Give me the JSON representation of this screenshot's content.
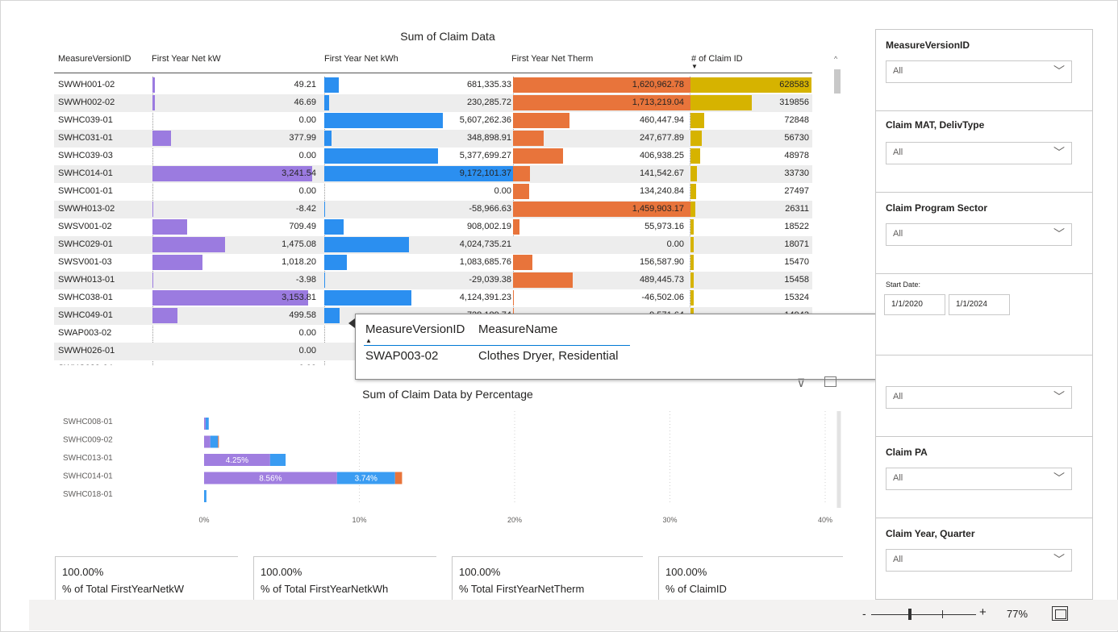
{
  "table": {
    "title": "Sum of Claim Data",
    "headers": [
      "MeasureVersionID",
      "First Year Net kW",
      "First Year Net kWh",
      "First Year Net Therm",
      "# of Claim ID"
    ],
    "rows": [
      {
        "id": "SWWH001-02",
        "kw": "49.21",
        "kwh": "681,335.33",
        "therm": "1,620,962.78",
        "claims": "628583",
        "kw_n": 49.21,
        "kwh_n": 681335.33,
        "therm_n": 1620962.78,
        "claims_n": 628583
      },
      {
        "id": "SWWH002-02",
        "kw": "46.69",
        "kwh": "230,285.72",
        "therm": "1,713,219.04",
        "claims": "319856",
        "kw_n": 46.69,
        "kwh_n": 230285.72,
        "therm_n": 1713219.04,
        "claims_n": 319856
      },
      {
        "id": "SWHC039-01",
        "kw": "0.00",
        "kwh": "5,607,262.36",
        "therm": "460,447.94",
        "claims": "72848",
        "kw_n": 0,
        "kwh_n": 5607262.36,
        "therm_n": 460447.94,
        "claims_n": 72848
      },
      {
        "id": "SWHC031-01",
        "kw": "377.99",
        "kwh": "348,898.91",
        "therm": "247,677.89",
        "claims": "56730",
        "kw_n": 377.99,
        "kwh_n": 348898.91,
        "therm_n": 247677.89,
        "claims_n": 56730
      },
      {
        "id": "SWHC039-03",
        "kw": "0.00",
        "kwh": "5,377,699.27",
        "therm": "406,938.25",
        "claims": "48978",
        "kw_n": 0,
        "kwh_n": 5377699.27,
        "therm_n": 406938.25,
        "claims_n": 48978
      },
      {
        "id": "SWHC014-01",
        "kw": "3,241.54",
        "kwh": "9,172,101.37",
        "therm": "141,542.67",
        "claims": "33730",
        "kw_n": 3241.54,
        "kwh_n": 9172101.37,
        "therm_n": 141542.67,
        "claims_n": 33730
      },
      {
        "id": "SWHC001-01",
        "kw": "0.00",
        "kwh": "0.00",
        "therm": "134,240.84",
        "claims": "27497",
        "kw_n": 0,
        "kwh_n": 0,
        "therm_n": 134240.84,
        "claims_n": 27497
      },
      {
        "id": "SWWH013-02",
        "kw": "-8.42",
        "kwh": "-58,966.63",
        "therm": "1,459,903.17",
        "claims": "26311",
        "kw_n": -8.42,
        "kwh_n": -58966.63,
        "therm_n": 1459903.17,
        "claims_n": 26311
      },
      {
        "id": "SWSV001-02",
        "kw": "709.49",
        "kwh": "908,002.19",
        "therm": "55,973.16",
        "claims": "18522",
        "kw_n": 709.49,
        "kwh_n": 908002.19,
        "therm_n": 55973.16,
        "claims_n": 18522
      },
      {
        "id": "SWHC029-01",
        "kw": "1,475.08",
        "kwh": "4,024,735.21",
        "therm": "0.00",
        "claims": "18071",
        "kw_n": 1475.08,
        "kwh_n": 4024735.21,
        "therm_n": 0,
        "claims_n": 18071
      },
      {
        "id": "SWSV001-03",
        "kw": "1,018.20",
        "kwh": "1,083,685.76",
        "therm": "156,587.90",
        "claims": "15470",
        "kw_n": 1018.2,
        "kwh_n": 1083685.76,
        "therm_n": 156587.9,
        "claims_n": 15470
      },
      {
        "id": "SWWH013-01",
        "kw": "-3.98",
        "kwh": "-29,039.38",
        "therm": "489,445.73",
        "claims": "15458",
        "kw_n": -3.98,
        "kwh_n": -29039.38,
        "therm_n": 489445.73,
        "claims_n": 15458
      },
      {
        "id": "SWHC038-01",
        "kw": "3,153.81",
        "kwh": "4,124,391.23",
        "therm": "-46,502.06",
        "claims": "15324",
        "kw_n": 3153.81,
        "kwh_n": 4124391.23,
        "therm_n": -46502.06,
        "claims_n": 15324
      },
      {
        "id": "SWHC049-01",
        "kw": "499.58",
        "kwh": "728,189.74",
        "therm": "-9,571.64",
        "claims": "14943",
        "kw_n": 499.58,
        "kwh_n": 728189.74,
        "therm_n": -9571.64,
        "claims_n": 14943
      },
      {
        "id": "SWAP003-02",
        "kw": "0.00",
        "kwh": "",
        "therm": "",
        "claims": "",
        "kw_n": 0,
        "kwh_n": 0,
        "therm_n": 0,
        "claims_n": 0
      },
      {
        "id": "SWWH026-01",
        "kw": "0.00",
        "kwh": "",
        "therm": "",
        "claims": "",
        "kw_n": 0,
        "kwh_n": 0,
        "therm_n": 0,
        "claims_n": 0
      },
      {
        "id": "SWHC039-04",
        "kw": "0.00",
        "kwh": "",
        "therm": "",
        "claims": "",
        "kw_n": 0,
        "kwh_n": 0,
        "therm_n": 0,
        "claims_n": 0
      }
    ]
  },
  "tooltip": {
    "headers": [
      "MeasureVersionID",
      "MeasureName"
    ],
    "id": "SWAP003-02",
    "name": "Clothes Dryer, Residential"
  },
  "chart_data": {
    "type": "bar",
    "title": "Sum of Claim Data by Percentage",
    "categories": [
      "SWHC008-01",
      "SWHC009-02",
      "SWHC013-01",
      "SWHC014-01",
      "SWHC018-01"
    ],
    "series": [
      {
        "values": [
          0.1,
          0.4,
          4.25,
          8.56,
          0.0
        ],
        "color": "#a07ee0"
      },
      {
        "values": [
          0.2,
          0.5,
          1.0,
          3.74,
          0.15
        ],
        "color": "#3a9cf2"
      },
      {
        "values": [
          0.0,
          0.05,
          0.0,
          0.45,
          0.0
        ],
        "color": "#e8743b"
      }
    ],
    "data_labels": [
      {
        "category": "SWHC013-01",
        "series": 0,
        "text": "4.25%"
      },
      {
        "category": "SWHC014-01",
        "series": 0,
        "text": "8.56%"
      },
      {
        "category": "SWHC014-01",
        "series": 1,
        "text": "3.74%"
      }
    ],
    "xticks": [
      "0%",
      "10%",
      "20%",
      "30%",
      "40%"
    ],
    "xlim": [
      0,
      40
    ],
    "orientation": "horizontal",
    "stacked": true
  },
  "kpis": [
    {
      "value": "100.00%",
      "label": "% of Total FirstYearNetkW"
    },
    {
      "value": "100.00%",
      "label": "% of Total FirstYearNetkWh"
    },
    {
      "value": "100.00%",
      "label": "% Total FirstYearNetTherm"
    },
    {
      "value": "100.00%",
      "label": "% of ClaimID"
    }
  ],
  "filters": [
    {
      "label": "MeasureVersionID",
      "value": "All"
    },
    {
      "label": "Claim MAT, DelivType",
      "value": "All"
    },
    {
      "label": "Claim Program Sector",
      "value": "All"
    },
    {
      "label": "Start Date:",
      "from": "1/1/2020",
      "to": "1/1/2024"
    },
    {
      "label": "",
      "value": "All"
    },
    {
      "label": "Claim PA",
      "value": "All"
    },
    {
      "label": "Claim Year, Quarter",
      "value": "All"
    }
  ],
  "zoom": {
    "minus": "-",
    "plus": "+",
    "level": "77%"
  },
  "colors": {
    "kw": "#9b7be0",
    "kwh": "#2b8ff0",
    "therm": "#e8743b",
    "claims": "#d6b300"
  }
}
